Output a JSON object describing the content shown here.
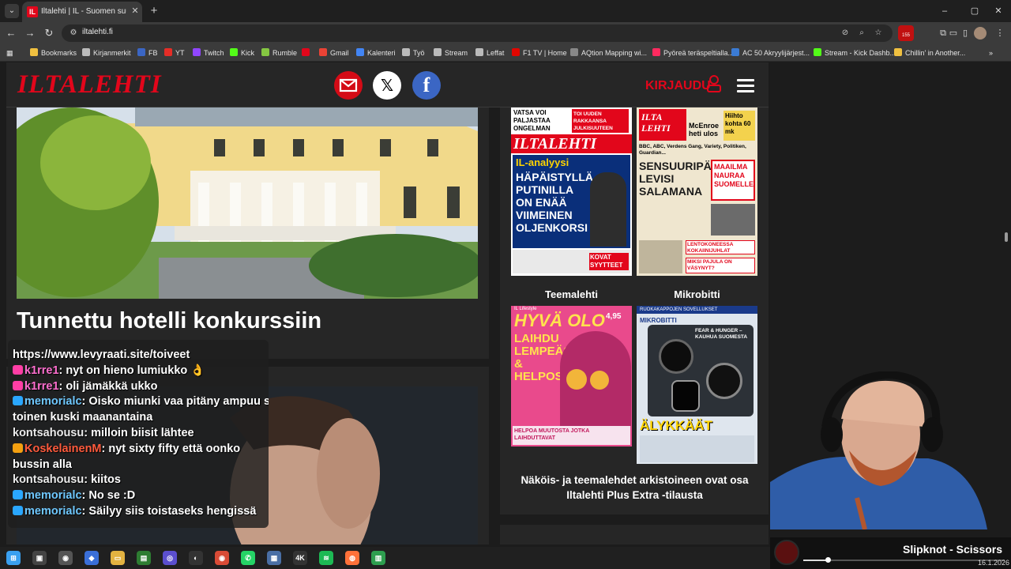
{
  "browser": {
    "tab_title": "Iltalehti | IL - Suomen suurin uu",
    "tab_icon_text": "IL",
    "new_tab_label": "+",
    "url": "iltalehti.fi",
    "extension_badge": "155",
    "window_controls": [
      "–",
      "▢",
      "✕"
    ]
  },
  "bookmarks": [
    {
      "label": "Bookmarks",
      "icon": "star-icon",
      "color": "#f0c040"
    },
    {
      "label": "Kirjanmerkit",
      "icon": "bookmark-icon",
      "color": "#bbbbbb"
    },
    {
      "label": "FB",
      "icon": "facebook-icon",
      "color": "#3b66c4"
    },
    {
      "label": "YT",
      "icon": "youtube-icon",
      "color": "#e52d27"
    },
    {
      "label": "Twitch",
      "icon": "twitch-icon",
      "color": "#9146ff"
    },
    {
      "label": "Kick",
      "icon": "kick-icon",
      "color": "#53fc18"
    },
    {
      "label": "Rumble",
      "icon": "rumble-icon",
      "color": "#85c742"
    },
    {
      "label": "",
      "icon": "iltalehti-icon",
      "color": "#e2061b"
    },
    {
      "label": "Gmail",
      "icon": "gmail-icon",
      "color": "#ea4335"
    },
    {
      "label": "Kalenteri",
      "icon": "calendar-icon",
      "color": "#4285f4"
    },
    {
      "label": "Työ",
      "icon": "folder-icon",
      "color": "#bbbbbb"
    },
    {
      "label": "Stream",
      "icon": "folder-icon",
      "color": "#bbbbbb"
    },
    {
      "label": "Leffat",
      "icon": "folder-icon",
      "color": "#bbbbbb"
    },
    {
      "label": "F1 TV | Home",
      "icon": "f1-icon",
      "color": "#e10600"
    },
    {
      "label": "AQtion Mapping wi...",
      "icon": "aqtion-icon",
      "color": "#888888"
    },
    {
      "label": "Pyöreä teräspeltialla...",
      "icon": "shop-icon",
      "color": "#ff2a5f"
    },
    {
      "label": "AC 50 Akryylijärjest...",
      "icon": "ac-icon",
      "color": "#3b7bd4"
    },
    {
      "label": "Stream - Kick Dashb...",
      "icon": "kick-icon",
      "color": "#53fc18"
    },
    {
      "label": "Chillin' in Another...",
      "icon": "music-icon",
      "color": "#f0c040"
    }
  ],
  "site": {
    "logo": "ILTALEHTI",
    "login": "KIRJAUDU",
    "headline": "Tunnettu hotelli konkurssiin"
  },
  "sidebar": {
    "magazines": [
      {
        "label": "Teemalehti"
      },
      {
        "label": "Mikrobitti"
      }
    ],
    "archive_note": "Näköis- ja teemalehdet arkistoineen ovat osa Iltalehti Plus Extra -tilausta",
    "covers": {
      "il1": {
        "brand": "ILTALEHTI",
        "top_left": "VATSA VOI PALJASTAA ONGELMAN",
        "top_right": "TOI UUDEN RAKKAANSA JULKISUUTEEN",
        "kicker": "IL-analyysi",
        "headline": "HÄPÄISTYLLÄ PUTINILLA ON ENÄÄ VIIMEINEN OLJENKORSI",
        "bottom": "KOVAT SYYTTEET"
      },
      "il2": {
        "brand": "ILTA LEHTI",
        "top": "McEnroe heti ulos",
        "side": "Hiihto kohta 60 mk",
        "strap": "BBC, ABC, Verdens Gang, Variety, Politiken, Guardian...",
        "headline": "SENSUURIPÄÄTÖS LEVISI SALAMANA",
        "box": "MAAILMA NAURAA SUOMELLE",
        "b1": "LENTOKONEESSA KOKAIINIJUHLAT",
        "b2": "MIKSI PAJULA ON VÄSYNYT?"
      },
      "teema": {
        "brand": "HYVÄ OLO",
        "kicker": "IL Lifestyle",
        "price": "4,95",
        "headline": "LAIHDU LEMPEÄSTI & HELPOSTI",
        "bottom": "HELPOA MUUTOSTA JOTKA LAIHDUTTAVAT"
      },
      "mikro": {
        "brand": "MIKROBITTI",
        "tag": "FEAR & HUNGER – KAUHUA SUOMESTA",
        "headline": "ÄLYKKÄÄT KELLOT"
      }
    }
  },
  "chat": [
    {
      "user": "",
      "text": "https://www.levyraati.site/toiveet",
      "color": "#ffffff",
      "badge": ""
    },
    {
      "user": "k1rre1",
      "text": ": nyt on hieno lumiukko 👌",
      "color": "#ff6fcf",
      "badge": "#ff3ea5"
    },
    {
      "user": "k1rre1",
      "text": ": oli jämäkkä ukko",
      "color": "#ff6fcf",
      "badge": "#ff3ea5"
    },
    {
      "user": "memorialc",
      "text": ": Oisko miunki vaa pitäny ampuu se",
      "color": "#6fc8ff",
      "badge": "#2aa7ff"
    },
    {
      "user": "",
      "text": "toinen kuski maanantaina",
      "color": "#ffffff",
      "badge": ""
    },
    {
      "user": "kontsahousu",
      "text": ": milloin biisit lähtee",
      "color": "#eaeaea",
      "badge": ""
    },
    {
      "user": "KoskelainenM",
      "text": ": nyt sixty fifty että oonko",
      "color": "#ff5a3c",
      "badge": "#f4a010"
    },
    {
      "user": "",
      "text": "bussin alla",
      "color": "#ffffff",
      "badge": ""
    },
    {
      "user": "kontsahousu",
      "text": ": kiitos",
      "color": "#eaeaea",
      "badge": ""
    },
    {
      "user": "memorialc",
      "text": ": No se :D",
      "color": "#6fc8ff",
      "badge": "#2aa7ff"
    },
    {
      "user": "memorialc",
      "text": ": Säilyy siis toistaseks hengissä",
      "color": "#6fc8ff",
      "badge": "#2aa7ff"
    }
  ],
  "now_playing": {
    "title": "Slipknot - Scissors",
    "progress": 0.12
  },
  "taskbar": {
    "apps": [
      {
        "name": "windows-icon",
        "color": "#3aa0f0",
        "glyph": "⊞"
      },
      {
        "name": "task-view-icon",
        "color": "#444",
        "glyph": "▣"
      },
      {
        "name": "app-icon",
        "color": "#555",
        "glyph": "◉"
      },
      {
        "name": "app-icon",
        "color": "#3a6fd8",
        "glyph": "◆"
      },
      {
        "name": "file-explorer-icon",
        "color": "#e3b341",
        "glyph": "▭"
      },
      {
        "name": "app-icon",
        "color": "#2e7d32",
        "glyph": "▤"
      },
      {
        "name": "app-icon",
        "color": "#5b4fcf",
        "glyph": "◎"
      },
      {
        "name": "app-icon",
        "color": "#333",
        "glyph": "◐"
      },
      {
        "name": "chrome-icon",
        "color": "#d94b36",
        "glyph": "◉"
      },
      {
        "name": "whatsapp-icon",
        "color": "#25d366",
        "glyph": "✆"
      },
      {
        "name": "app-icon",
        "color": "#4a6fa5",
        "glyph": "▦"
      },
      {
        "name": "app-icon",
        "color": "#333",
        "glyph": "4K"
      },
      {
        "name": "spotify-icon",
        "color": "#1db954",
        "glyph": "≋"
      },
      {
        "name": "firefox-icon",
        "color": "#ff7139",
        "glyph": "◍"
      },
      {
        "name": "app-icon",
        "color": "#2e9e4f",
        "glyph": "▥"
      }
    ],
    "date": "16.1.2026"
  }
}
